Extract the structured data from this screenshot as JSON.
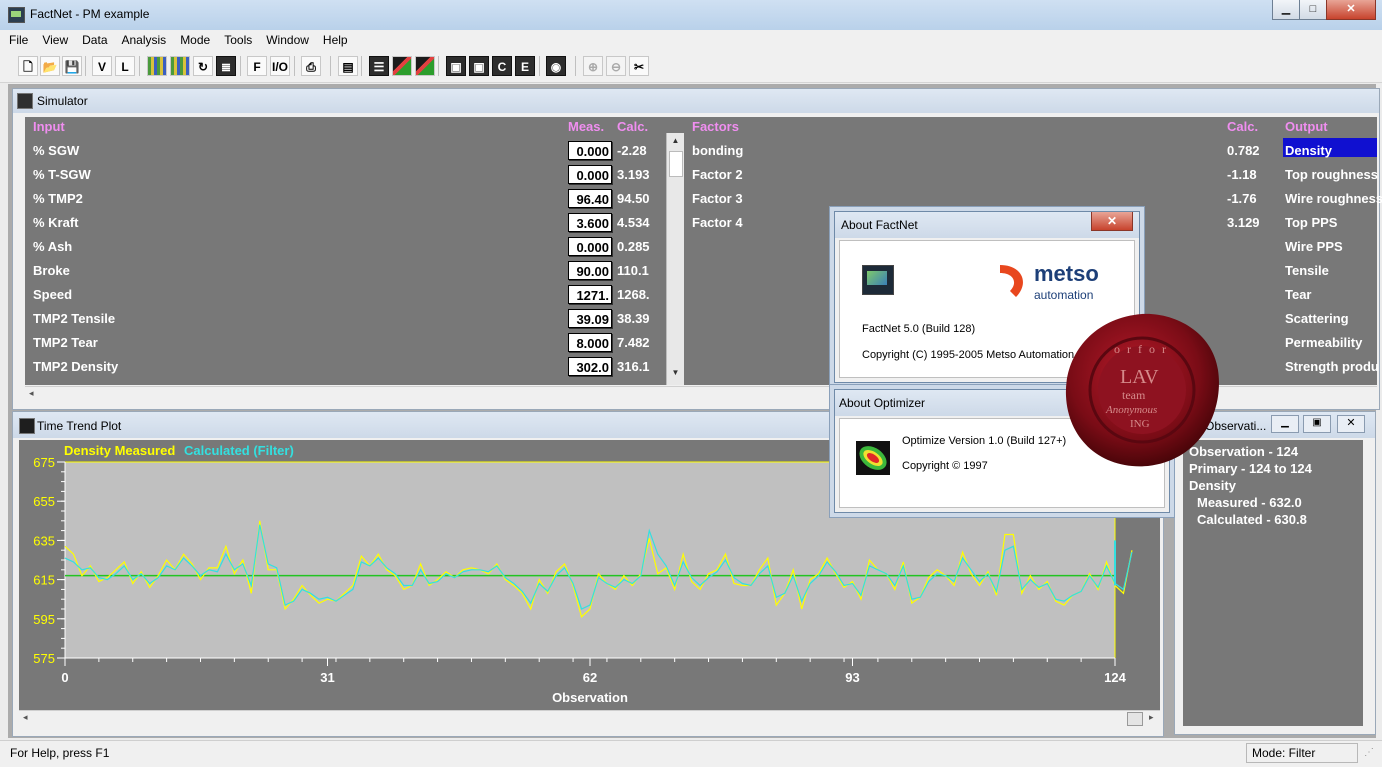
{
  "app": {
    "title": "FactNet - PM example",
    "caption_buttons": {
      "minimize": "▁",
      "maximize": "□",
      "close": "✕"
    }
  },
  "menu": [
    "File",
    "View",
    "Data",
    "Analysis",
    "Mode",
    "Tools",
    "Window",
    "Help"
  ],
  "toolbar": [
    {
      "name": "new-file-icon",
      "glyph": "🗋",
      "style": ""
    },
    {
      "name": "open-folder-icon",
      "glyph": "📂",
      "style": ""
    },
    {
      "name": "save-icon",
      "glyph": "💾",
      "style": ""
    },
    {
      "name": "v-tool-button",
      "glyph": "V",
      "style": ""
    },
    {
      "name": "l-tool-button",
      "glyph": "L",
      "style": ""
    },
    {
      "name": "grid-view-icon",
      "glyph": "",
      "style": "grid"
    },
    {
      "name": "color-grid-icon",
      "glyph": "",
      "style": "grid"
    },
    {
      "name": "refresh-icon",
      "glyph": "↻",
      "style": ""
    },
    {
      "name": "list-view-icon",
      "glyph": "≣",
      "style": "dark"
    },
    {
      "name": "f-tool-button",
      "glyph": "F",
      "style": ""
    },
    {
      "name": "io-tool-button",
      "glyph": "I/O",
      "style": ""
    },
    {
      "name": "print-icon",
      "glyph": "⎙",
      "style": ""
    },
    {
      "name": "properties-icon",
      "glyph": "▤",
      "style": ""
    },
    {
      "name": "table-view-icon",
      "glyph": "☰",
      "style": "dark"
    },
    {
      "name": "bar-chart-icon",
      "glyph": "",
      "style": "chart"
    },
    {
      "name": "trend-chart-icon",
      "glyph": "",
      "style": "chart"
    },
    {
      "name": "model-a-icon",
      "glyph": "▣",
      "style": "dark"
    },
    {
      "name": "model-b-icon",
      "glyph": "▣",
      "style": "dark"
    },
    {
      "name": "model-c-icon",
      "glyph": "C",
      "style": "dark"
    },
    {
      "name": "model-e-icon",
      "glyph": "E",
      "style": "dark"
    },
    {
      "name": "optimizer-icon",
      "glyph": "◉",
      "style": "dark"
    },
    {
      "name": "zoom-in-icon",
      "glyph": "⊕",
      "style": "dis"
    },
    {
      "name": "zoom-out-icon",
      "glyph": "⊖",
      "style": "dis"
    },
    {
      "name": "cut-icon",
      "glyph": "✂",
      "style": ""
    }
  ],
  "simulator": {
    "title": "Simulator",
    "headers": {
      "input": "Input",
      "meas": "Meas.",
      "calc": "Calc.",
      "factors": "Factors",
      "calc2": "Calc.",
      "output": "Output"
    },
    "inputs": [
      {
        "label": "% SGW",
        "meas": "0.000",
        "calc": "-2.28"
      },
      {
        "label": "% T-SGW",
        "meas": "0.000",
        "calc": "3.193"
      },
      {
        "label": "% TMP2",
        "meas": "96.40",
        "calc": "94.50"
      },
      {
        "label": "% Kraft",
        "meas": "3.600",
        "calc": "4.534"
      },
      {
        "label": "% Ash",
        "meas": "0.000",
        "calc": "0.285"
      },
      {
        "label": "Broke",
        "meas": "90.00",
        "calc": "110.1"
      },
      {
        "label": "Speed",
        "meas": "1271.",
        "calc": "1268."
      },
      {
        "label": "TMP2 Tensile",
        "meas": "39.09",
        "calc": "38.39"
      },
      {
        "label": "TMP2 Tear",
        "meas": "8.000",
        "calc": "7.482"
      },
      {
        "label": "TMP2 Density",
        "meas": "302.0",
        "calc": "316.1"
      }
    ],
    "factors": [
      "bonding",
      "Factor 2",
      "Factor 3",
      "Factor 4"
    ],
    "outputs": [
      {
        "label": "Density",
        "calc": "0.782"
      },
      {
        "label": "Top roughness",
        "calc": "-1.18"
      },
      {
        "label": "Wire roughness",
        "calc": "-1.76"
      },
      {
        "label": "Top PPS",
        "calc": "3.129"
      },
      {
        "label": "Wire PPS",
        "calc": ""
      },
      {
        "label": "Tensile",
        "calc": ""
      },
      {
        "label": "Tear",
        "calc": ""
      },
      {
        "label": "Scattering",
        "calc": ""
      },
      {
        "label": "Permeability",
        "calc": ""
      },
      {
        "label": "Strength produ",
        "calc": ""
      }
    ]
  },
  "trend": {
    "title": "Time Trend Plot",
    "legend_measured": "Density Measured",
    "legend_calculated": "Calculated (Filter)",
    "colors": {
      "measured": "#ffff00",
      "calculated": "#33e0e0",
      "mean": "#22c422",
      "plot_bg": "#c0c0c0",
      "panel_bg": "#787878"
    }
  },
  "observation": {
    "title": "Observati...",
    "lines": [
      "Observation - 124",
      "Primary - 124 to 124",
      "Density"
    ],
    "indented": [
      "Measured - 632.0",
      "Calculated - 630.8"
    ]
  },
  "about_factnet": {
    "title": "About FactNet",
    "close": "✕",
    "logo_word": "metso",
    "logo_sub": "automation",
    "version": "FactNet 5.0 (Build 128)",
    "copyright": "Copyright (C) 1995-2005 Metso Automation"
  },
  "about_optimizer": {
    "title": "About Optimizer",
    "version": "Optimize Version 1.0 (Build 127+)",
    "copyright": "Copyright © 1997"
  },
  "seal": {
    "top": "o r f o r",
    "lines": [
      "LAV",
      "team",
      "Anonymous",
      "ING"
    ]
  },
  "status": {
    "help": "For Help, press F1",
    "mode": "Mode: Filter"
  },
  "chart_data": {
    "type": "line",
    "title": "",
    "xlabel": "Observation",
    "ylabel": "",
    "xlim": [
      0,
      124
    ],
    "ylim": [
      575,
      675
    ],
    "x_ticks": [
      0,
      31,
      62,
      93,
      124
    ],
    "y_ticks": [
      675,
      655,
      635,
      615,
      595,
      575
    ],
    "mean_line": 617,
    "series": [
      {
        "name": "Density Measured",
        "color": "#ffff00",
        "values": [
          632,
          628,
          617,
          622,
          614,
          616,
          620,
          624,
          613,
          619,
          611,
          617,
          625,
          620,
          628,
          623,
          615,
          621,
          621,
          632,
          618,
          625,
          608,
          645,
          620,
          620,
          600,
          605,
          612,
          607,
          603,
          605,
          604,
          608,
          612,
          627,
          622,
          628,
          620,
          617,
          610,
          612,
          623,
          612,
          615,
          619,
          616,
          620,
          621,
          620,
          618,
          623,
          615,
          612,
          608,
          600,
          615,
          608,
          619,
          623,
          612,
          596,
          600,
          618,
          613,
          610,
          617,
          612,
          618,
          636,
          618,
          621,
          610,
          628,
          614,
          610,
          618,
          620,
          628,
          613,
          612,
          612,
          620,
          626,
          602,
          608,
          620,
          600,
          615,
          618,
          626,
          618,
          611,
          614,
          605,
          625,
          620,
          618,
          610,
          624,
          603,
          606,
          616,
          620,
          617,
          612,
          629,
          618,
          612,
          619,
          607,
          638,
          638,
          608,
          617,
          610,
          614,
          604,
          602,
          607,
          609,
          618,
          610,
          624,
          612,
          608,
          630
        ]
      },
      {
        "name": "Calculated (Filter)",
        "color": "#33e0e0",
        "values": [
          626,
          624,
          620,
          621,
          616,
          615,
          618,
          622,
          615,
          618,
          613,
          616,
          622,
          620,
          626,
          622,
          617,
          620,
          619,
          628,
          620,
          623,
          612,
          643,
          623,
          621,
          602,
          604,
          610,
          608,
          605,
          606,
          604,
          607,
          610,
          624,
          622,
          626,
          621,
          618,
          612,
          612,
          620,
          613,
          614,
          618,
          616,
          619,
          620,
          620,
          619,
          622,
          616,
          613,
          609,
          603,
          613,
          609,
          617,
          621,
          613,
          600,
          602,
          616,
          613,
          611,
          615,
          613,
          617,
          640,
          628,
          622,
          612,
          624,
          616,
          612,
          616,
          619,
          625,
          616,
          613,
          612,
          618,
          622,
          606,
          608,
          617,
          604,
          613,
          617,
          624,
          619,
          612,
          613,
          607,
          622,
          620,
          618,
          612,
          622,
          605,
          606,
          614,
          618,
          617,
          614,
          626,
          620,
          614,
          618,
          609,
          630,
          632,
          610,
          615,
          611,
          613,
          605,
          604,
          607,
          609,
          617,
          611,
          622,
          613,
          610,
          629
        ]
      }
    ]
  }
}
